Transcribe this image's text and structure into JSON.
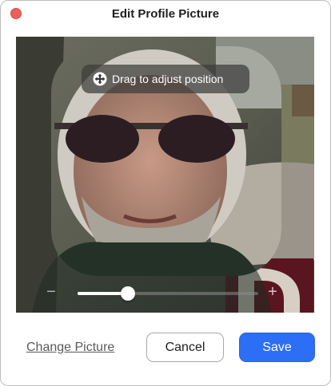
{
  "window": {
    "title": "Edit Profile Picture"
  },
  "photo": {
    "hint_label": "Drag to adjust position",
    "hint_icon": "move-icon"
  },
  "zoom": {
    "minus_symbol": "−",
    "plus_symbol": "+",
    "level": 0.28
  },
  "footer": {
    "change_label": "Change Picture",
    "cancel_label": "Cancel",
    "save_label": "Save"
  },
  "colors": {
    "accent": "#2d6ef7",
    "close": "#ec5f5a"
  }
}
